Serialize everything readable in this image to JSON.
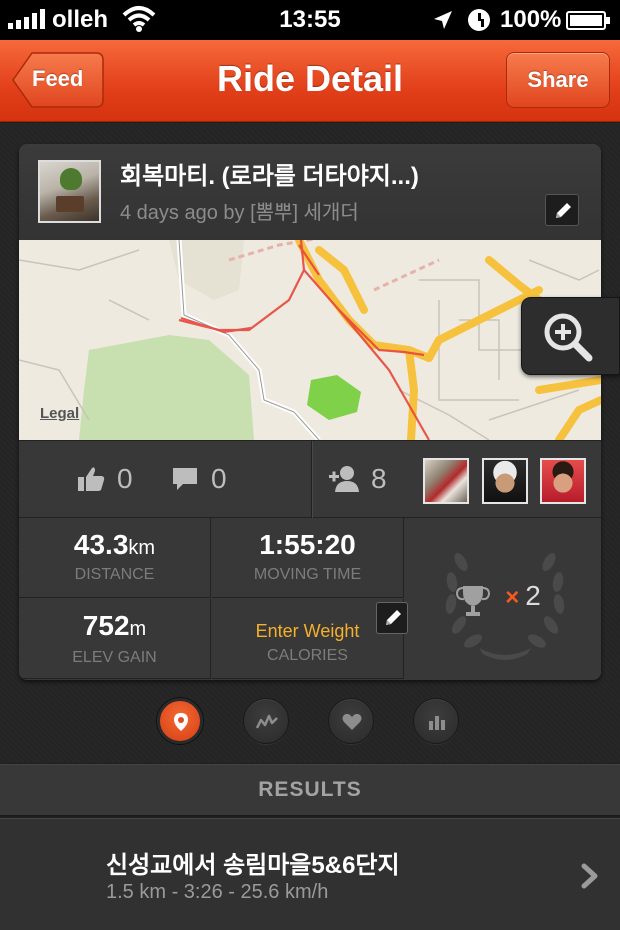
{
  "status_bar": {
    "carrier": "olleh",
    "time": "13:55",
    "battery": "100%"
  },
  "nav": {
    "back_label": "Feed",
    "title": "Ride Detail",
    "share_label": "Share"
  },
  "ride": {
    "title": "회복마티. (로라를 더타야지...)",
    "subtitle": "4 days ago by [뽐뿌] 세개더",
    "map_legal": "Legal"
  },
  "social": {
    "kudos_count": "0",
    "comments_count": "0",
    "riders_count": "8"
  },
  "stats": {
    "distance_value": "43.3",
    "distance_unit": "km",
    "distance_label": "DISTANCE",
    "moving_time_value": "1:55:20",
    "moving_time_label": "MOVING TIME",
    "elev_value": "752",
    "elev_unit": "m",
    "elev_label": "ELEV GAIN",
    "calories_value": "Enter Weight",
    "calories_label": "CALORIES",
    "achievements_count": "2"
  },
  "tabs": [
    "map-tab",
    "analysis-tab",
    "heart-tab",
    "segments-tab"
  ],
  "results": {
    "header": "RESULTS",
    "items": [
      {
        "title": "신성교에서 송림마을5&6단지",
        "detail": "1.5 km - 3:26 - 25.6 km/h"
      }
    ]
  },
  "colors": {
    "brand": "#e8481f",
    "accent_text": "#f5b12c",
    "background": "#242424"
  }
}
